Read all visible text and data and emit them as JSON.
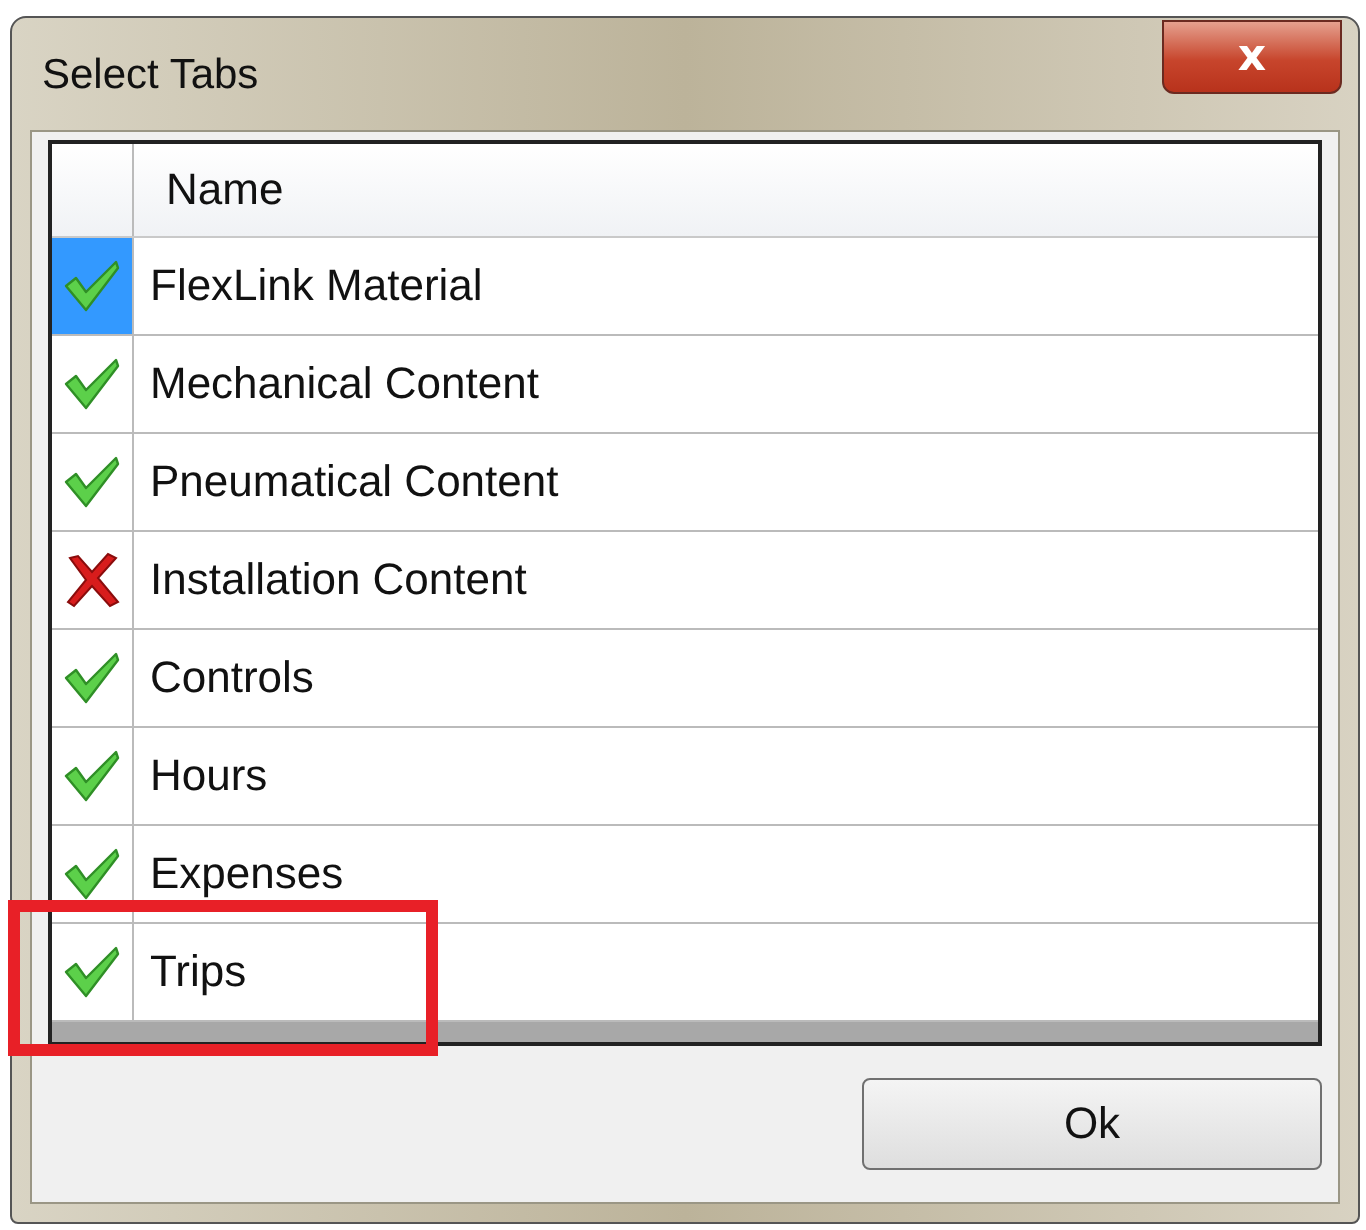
{
  "window": {
    "title": "Select Tabs",
    "close_label": "x"
  },
  "table": {
    "columns": [
      "Name"
    ],
    "rows": [
      {
        "name": "FlexLink Material",
        "included": true,
        "selected": true,
        "highlighted": false
      },
      {
        "name": "Mechanical Content",
        "included": true,
        "selected": false,
        "highlighted": false
      },
      {
        "name": "Pneumatical Content",
        "included": true,
        "selected": false,
        "highlighted": false
      },
      {
        "name": "Installation Content",
        "included": false,
        "selected": false,
        "highlighted": false
      },
      {
        "name": "Controls",
        "included": true,
        "selected": false,
        "highlighted": false
      },
      {
        "name": "Hours",
        "included": true,
        "selected": false,
        "highlighted": false
      },
      {
        "name": "Expenses",
        "included": true,
        "selected": false,
        "highlighted": false
      },
      {
        "name": "Trips",
        "included": true,
        "selected": false,
        "highlighted": true
      }
    ]
  },
  "buttons": [
    "Ok"
  ]
}
